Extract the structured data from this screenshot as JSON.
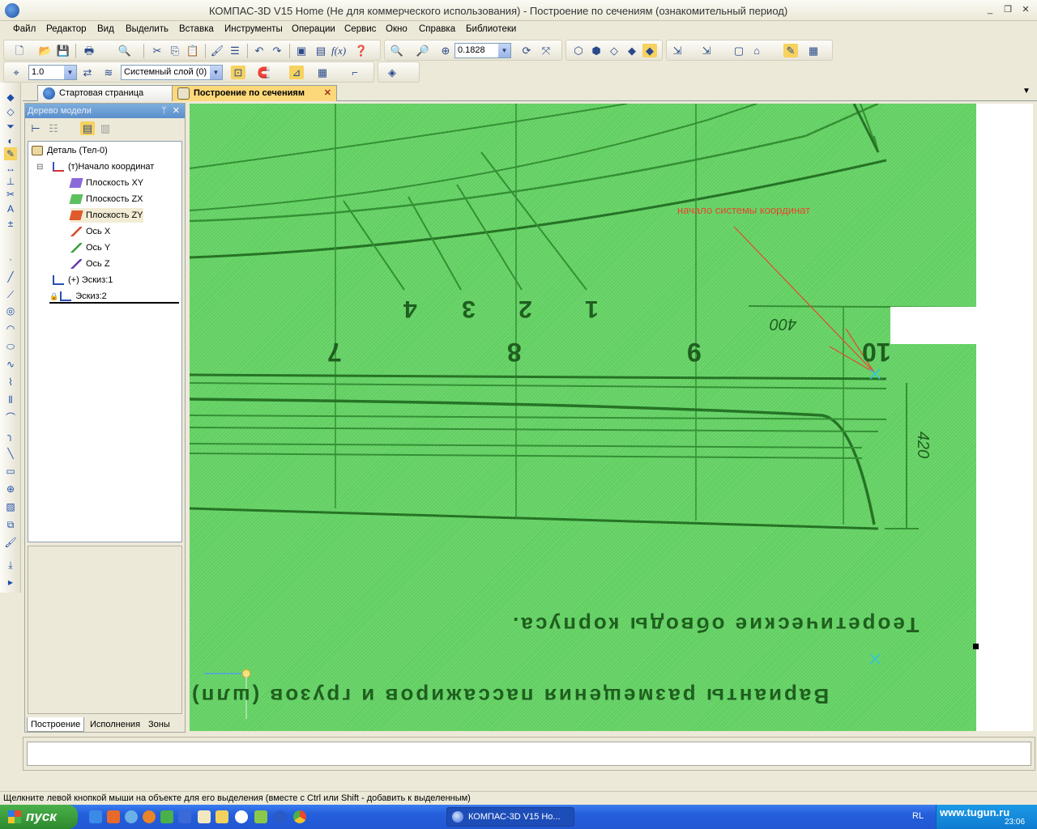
{
  "window": {
    "title": "КОМПАС-3D V15 Home (Не для коммерческого использования) - Построение по сечениям (ознакомительный период)",
    "controls": [
      "_",
      "❐",
      "✕"
    ]
  },
  "menu": [
    "Файл",
    "Редактор",
    "Вид",
    "Выделить",
    "Вставка",
    "Инструменты",
    "Операции",
    "Сервис",
    "Окно",
    "Справка",
    "Библиотеки"
  ],
  "toolbar": {
    "zoom_value": "0.1828",
    "step_value": "1.0",
    "layer_value": "Системный слой (0)"
  },
  "tabs": [
    {
      "label": "Стартовая страница",
      "active": false
    },
    {
      "label": "Построение по сечениям",
      "active": true,
      "close": "✕"
    }
  ],
  "model_tree": {
    "caption": "Дерево модели",
    "caption_buttons": [
      "ᛘ",
      "✕"
    ],
    "items": [
      {
        "label": "Деталь (Тел-0)",
        "icon": "part-icon"
      },
      {
        "label": "(т)Начало координат",
        "icon": "origin-icon",
        "expander": "⊟"
      },
      {
        "label": "Плоскость XY",
        "icon": "plane-xy-icon"
      },
      {
        "label": "Плоскость ZX",
        "icon": "plane-zx-icon"
      },
      {
        "label": "Плоскость ZY",
        "icon": "plane-zy-icon"
      },
      {
        "label": "Ось X",
        "icon": "axis-x-icon"
      },
      {
        "label": "Ось Y",
        "icon": "axis-y-icon"
      },
      {
        "label": "Ось Z",
        "icon": "axis-z-icon"
      },
      {
        "label": "(+) Эскиз:1",
        "icon": "sketch-icon"
      },
      {
        "label": "Эскиз:2",
        "icon": "sketch-locked-icon"
      }
    ],
    "bottom_tabs": [
      "Построение",
      "Исполнения",
      "Зоны"
    ]
  },
  "drawing": {
    "annotation": "начало системы координат",
    "station_numbers_top": [
      "4",
      "3",
      "2",
      "1"
    ],
    "station_numbers_mid": [
      "7",
      "8",
      "9",
      "10"
    ],
    "dim_400": "400",
    "dim_420": "420",
    "caption_1": "Теоретические обводы корпуса.",
    "caption_2": "Варианты размещения пассажиров и грузов (шлп)"
  },
  "status_text": "Щелкните левой кнопкой мыши на объекте для его выделения (вместе с Ctrl или Shift - добавить к выделенным)",
  "taskbar": {
    "start_label": "пуск",
    "task_button": "КОМПАС-3D V15 Ho...",
    "lang": "RL",
    "site": "www.tugun.ru",
    "clock": "23:06"
  },
  "colors": {
    "canvas_green": "#5fcf5f",
    "line_dark": "#1f6a1f",
    "annotation_red": "#e8472e",
    "active_tab": "#fdd87a"
  }
}
